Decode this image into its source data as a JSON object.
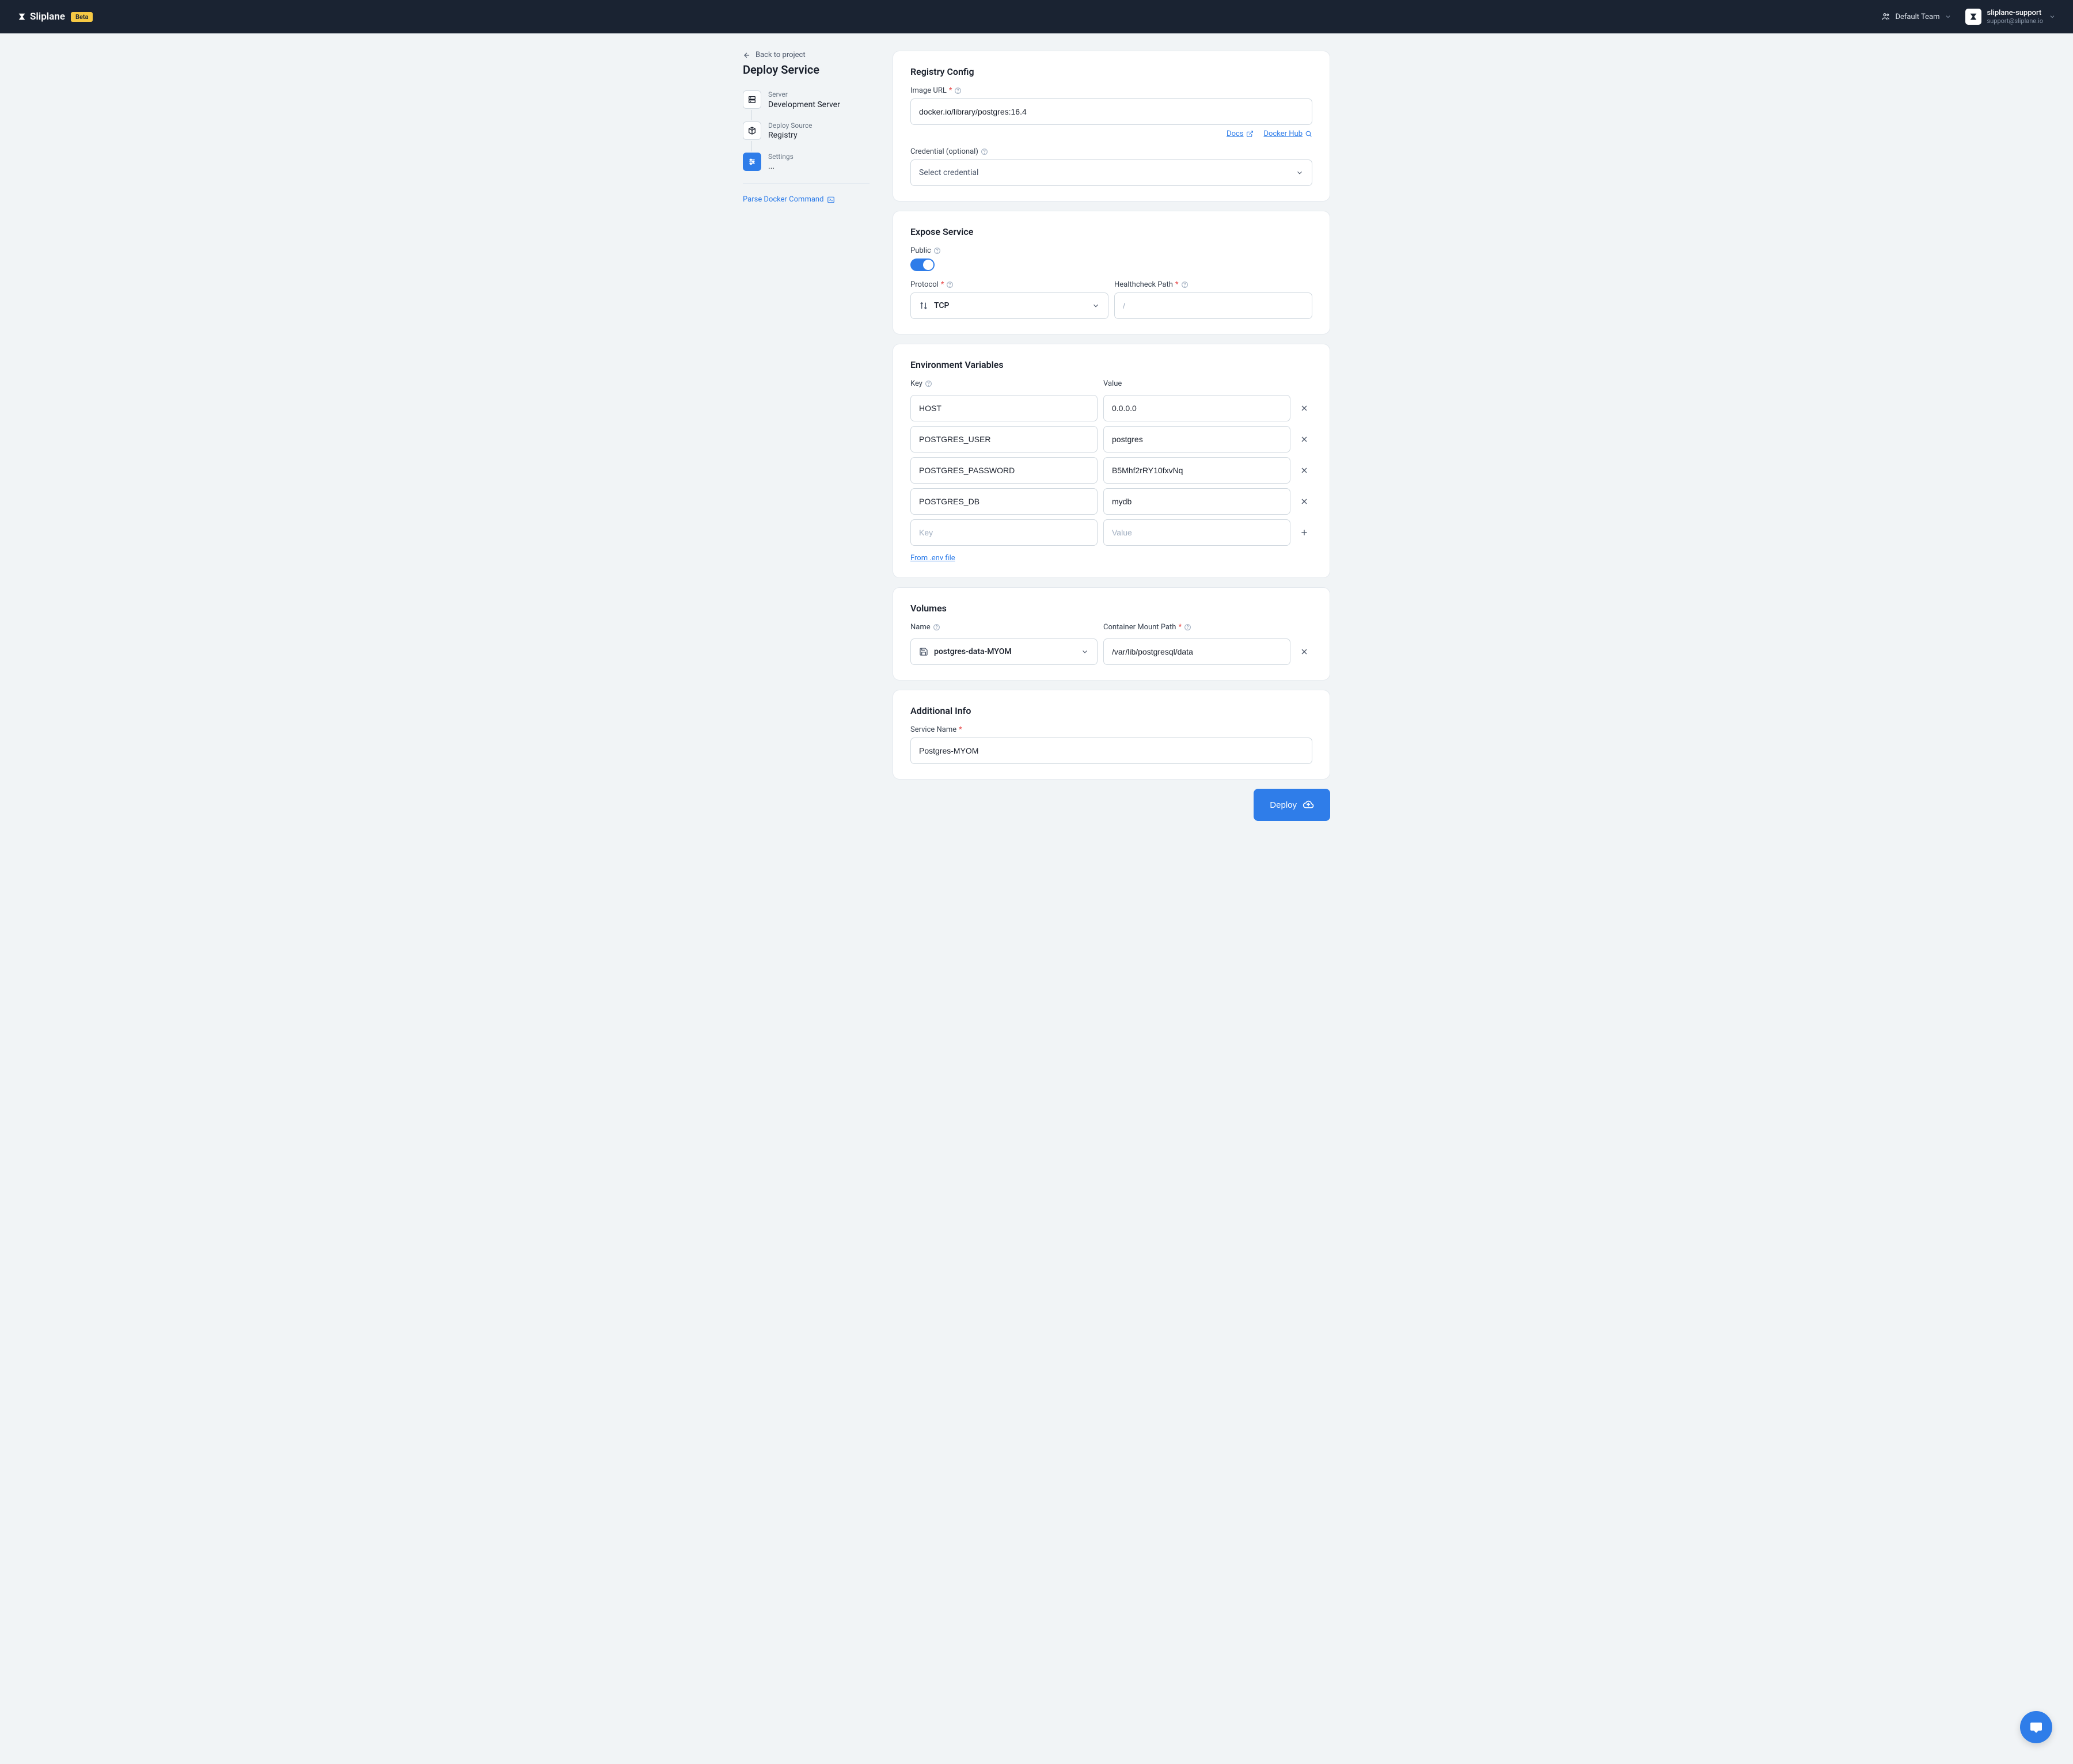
{
  "header": {
    "brand": "Sliplane",
    "beta": "Beta",
    "team": "Default Team",
    "user_name": "sliplane-support",
    "user_email": "support@sliplane.io"
  },
  "sidebar": {
    "back": "Back to project",
    "title": "Deploy Service",
    "steps": [
      {
        "label": "Server",
        "value": "Development Server"
      },
      {
        "label": "Deploy Source",
        "value": "Registry"
      },
      {
        "label": "Settings",
        "value": "..."
      }
    ],
    "parse": "Parse Docker Command"
  },
  "registry": {
    "title": "Registry Config",
    "image_label": "Image URL",
    "image_value": "docker.io/library/postgres:16.4",
    "docs": "Docs",
    "dockerhub": "Docker Hub",
    "cred_label": "Credential (optional)",
    "cred_placeholder": "Select credential"
  },
  "expose": {
    "title": "Expose Service",
    "public_label": "Public",
    "protocol_label": "Protocol",
    "protocol_value": "TCP",
    "health_label": "Healthcheck Path",
    "health_placeholder": "/"
  },
  "env": {
    "title": "Environment Variables",
    "key_label": "Key",
    "value_label": "Value",
    "rows": [
      {
        "key": "HOST",
        "value": "0.0.0.0"
      },
      {
        "key": "POSTGRES_USER",
        "value": "postgres"
      },
      {
        "key": "POSTGRES_PASSWORD",
        "value": "B5Mhf2rRY10fxvNq"
      },
      {
        "key": "POSTGRES_DB",
        "value": "mydb"
      }
    ],
    "key_placeholder": "Key",
    "value_placeholder": "Value",
    "from_env": "From .env file"
  },
  "volumes": {
    "title": "Volumes",
    "name_label": "Name",
    "name_value": "postgres-data-MYOM",
    "mount_label": "Container Mount Path",
    "mount_value": "/var/lib/postgresql/data"
  },
  "additional": {
    "title": "Additional Info",
    "name_label": "Service Name",
    "name_value": "Postgres-MYOM"
  },
  "deploy": "Deploy"
}
